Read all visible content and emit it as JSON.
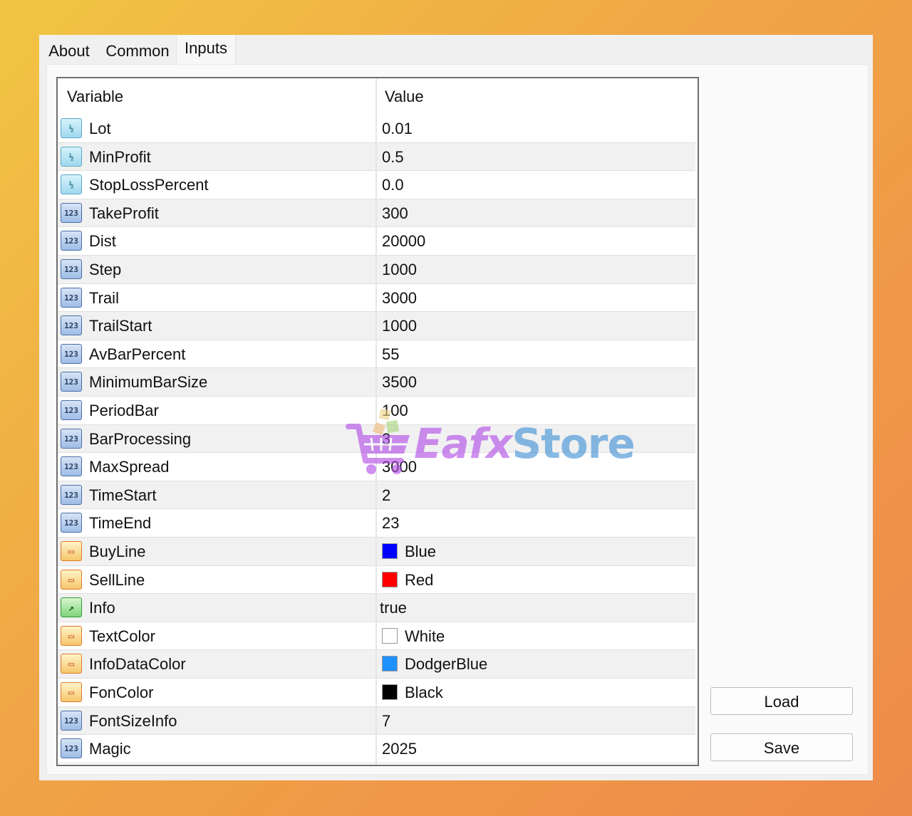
{
  "tabs": [
    {
      "label": "About"
    },
    {
      "label": "Common"
    },
    {
      "label": "Inputs"
    }
  ],
  "table": {
    "headers": {
      "variable": "Variable",
      "value": "Value"
    },
    "rows": [
      {
        "type": "double",
        "icon_glyph": "½",
        "name": "Lot",
        "value": "0.01"
      },
      {
        "type": "double",
        "icon_glyph": "½",
        "name": "MinProfit",
        "value": "0.5"
      },
      {
        "type": "double",
        "icon_glyph": "½",
        "name": "StopLossPercent",
        "value": "0.0"
      },
      {
        "type": "int",
        "icon_glyph": "123",
        "name": "TakeProfit",
        "value": "300"
      },
      {
        "type": "int",
        "icon_glyph": "123",
        "name": "Dist",
        "value": "20000"
      },
      {
        "type": "int",
        "icon_glyph": "123",
        "name": "Step",
        "value": "1000"
      },
      {
        "type": "int",
        "icon_glyph": "123",
        "name": "Trail",
        "value": "3000"
      },
      {
        "type": "int",
        "icon_glyph": "123",
        "name": "TrailStart",
        "value": "1000"
      },
      {
        "type": "int",
        "icon_glyph": "123",
        "name": "AvBarPercent",
        "value": "55"
      },
      {
        "type": "int",
        "icon_glyph": "123",
        "name": "MinimumBarSize",
        "value": "3500"
      },
      {
        "type": "int",
        "icon_glyph": "123",
        "name": "PeriodBar",
        "value": "100"
      },
      {
        "type": "int",
        "icon_glyph": "123",
        "name": "BarProcessing",
        "value": "3"
      },
      {
        "type": "int",
        "icon_glyph": "123",
        "name": "MaxSpread",
        "value": "3000"
      },
      {
        "type": "int",
        "icon_glyph": "123",
        "name": "TimeStart",
        "value": "2"
      },
      {
        "type": "int",
        "icon_glyph": "123",
        "name": "TimeEnd",
        "value": "23"
      },
      {
        "type": "color",
        "icon_glyph": "▭",
        "name": "BuyLine",
        "value": "Blue",
        "swatch": "#0000ff"
      },
      {
        "type": "color",
        "icon_glyph": "▭",
        "name": "SellLine",
        "value": "Red",
        "swatch": "#ff0000"
      },
      {
        "type": "bool",
        "icon_glyph": "↗",
        "name": "Info",
        "value": "true"
      },
      {
        "type": "color",
        "icon_glyph": "▭",
        "name": "TextColor",
        "value": "White",
        "swatch": "#ffffff"
      },
      {
        "type": "color",
        "icon_glyph": "▭",
        "name": "InfoDataColor",
        "value": "DodgerBlue",
        "swatch": "#1e90ff"
      },
      {
        "type": "color",
        "icon_glyph": "▭",
        "name": "FonColor",
        "value": "Black",
        "swatch": "#000000"
      },
      {
        "type": "int",
        "icon_glyph": "123",
        "name": "FontSizeInfo",
        "value": "7"
      },
      {
        "type": "int",
        "icon_glyph": "123",
        "name": "Magic",
        "value": "2025"
      }
    ]
  },
  "buttons": {
    "load": "Load",
    "save": "Save"
  },
  "watermark": {
    "text_a": "Eafx",
    "text_b": "Store",
    "icon": "shopping-cart-icon"
  },
  "colors": {
    "background_start": "#f1c543",
    "background_end": "#ee8a4a",
    "watermark_purple": "#b24be6",
    "watermark_blue": "#3f8fd6"
  }
}
